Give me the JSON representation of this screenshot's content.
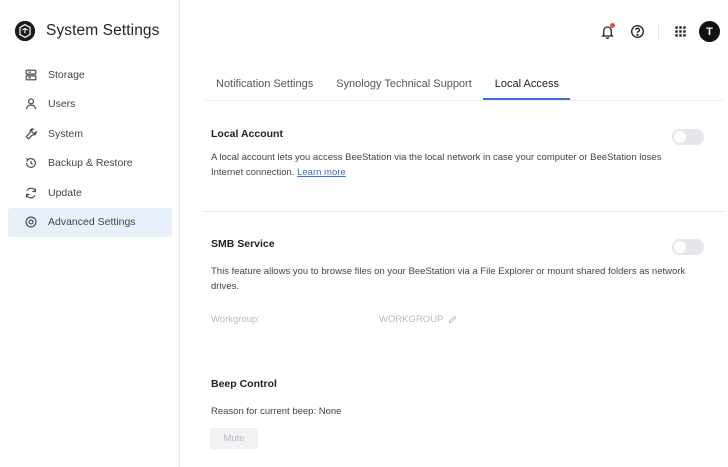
{
  "app": {
    "title": "System Settings"
  },
  "sidebar": {
    "items": [
      {
        "label": "Storage",
        "icon": "storage-icon",
        "active": false
      },
      {
        "label": "Users",
        "icon": "user-icon",
        "active": false
      },
      {
        "label": "System",
        "icon": "wrench-icon",
        "active": false
      },
      {
        "label": "Backup & Restore",
        "icon": "backup-restore-icon",
        "active": false
      },
      {
        "label": "Update",
        "icon": "update-icon",
        "active": false
      },
      {
        "label": "Advanced Settings",
        "icon": "advanced-settings-icon",
        "active": true
      }
    ]
  },
  "header": {
    "icons": [
      "notification-bell-icon",
      "help-icon",
      "apps-grid-icon"
    ],
    "avatar_initial": "T"
  },
  "tabs": [
    {
      "label": "Notification Settings",
      "active": false
    },
    {
      "label": "Synology Technical Support",
      "active": false
    },
    {
      "label": "Local Access",
      "active": true
    }
  ],
  "local_account": {
    "title": "Local Account",
    "description": "A local account lets you access BeeStation via the local network in case your computer or BeeStation loses Internet connection.",
    "link": "Learn more",
    "enabled": false
  },
  "smb_service": {
    "title": "SMB Service",
    "description": "This feature allows you to browse files on your BeeStation via a File Explorer or mount shared folders as network drives.",
    "enabled": false,
    "workgroup_label": "Workgroup:",
    "workgroup_value": "WORKGROUP"
  },
  "beep_control": {
    "title": "Beep Control",
    "reason": "Reason for current beep: None",
    "mute_label": "Mute"
  },
  "colors": {
    "accent": "#3a6fd8",
    "active_nav_bg": "#e8f0fb",
    "notification_dot": "#e5484d",
    "toggle_off": "#e4e6ea"
  }
}
